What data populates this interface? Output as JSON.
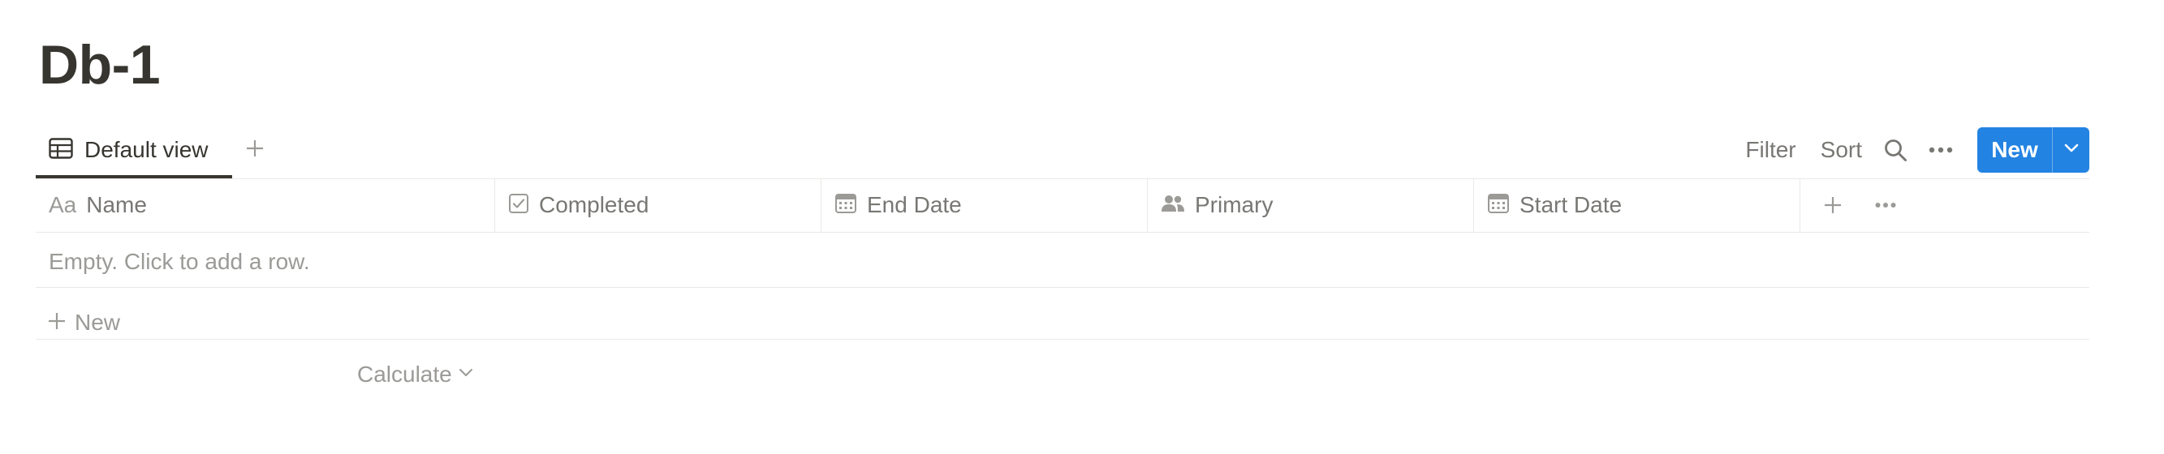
{
  "page": {
    "title": "Db-1"
  },
  "toolbar": {
    "view_tab_label": "Default view",
    "filter_label": "Filter",
    "sort_label": "Sort",
    "new_label": "New"
  },
  "table": {
    "columns": [
      {
        "label": "Name",
        "icon": "text-property-icon",
        "icon_text": "Aa"
      },
      {
        "label": "Completed",
        "icon": "checkbox-icon"
      },
      {
        "label": "End Date",
        "icon": "calendar-icon"
      },
      {
        "label": "Primary",
        "icon": "people-icon"
      },
      {
        "label": "Start Date",
        "icon": "calendar-icon"
      }
    ],
    "empty_message": "Empty. Click to add a row.",
    "new_row_label": "New",
    "calculate_label": "Calculate"
  },
  "colors": {
    "accent": "#2383e2",
    "text": "#37352f",
    "muted": "#787774",
    "border": "#e9e9e7"
  }
}
